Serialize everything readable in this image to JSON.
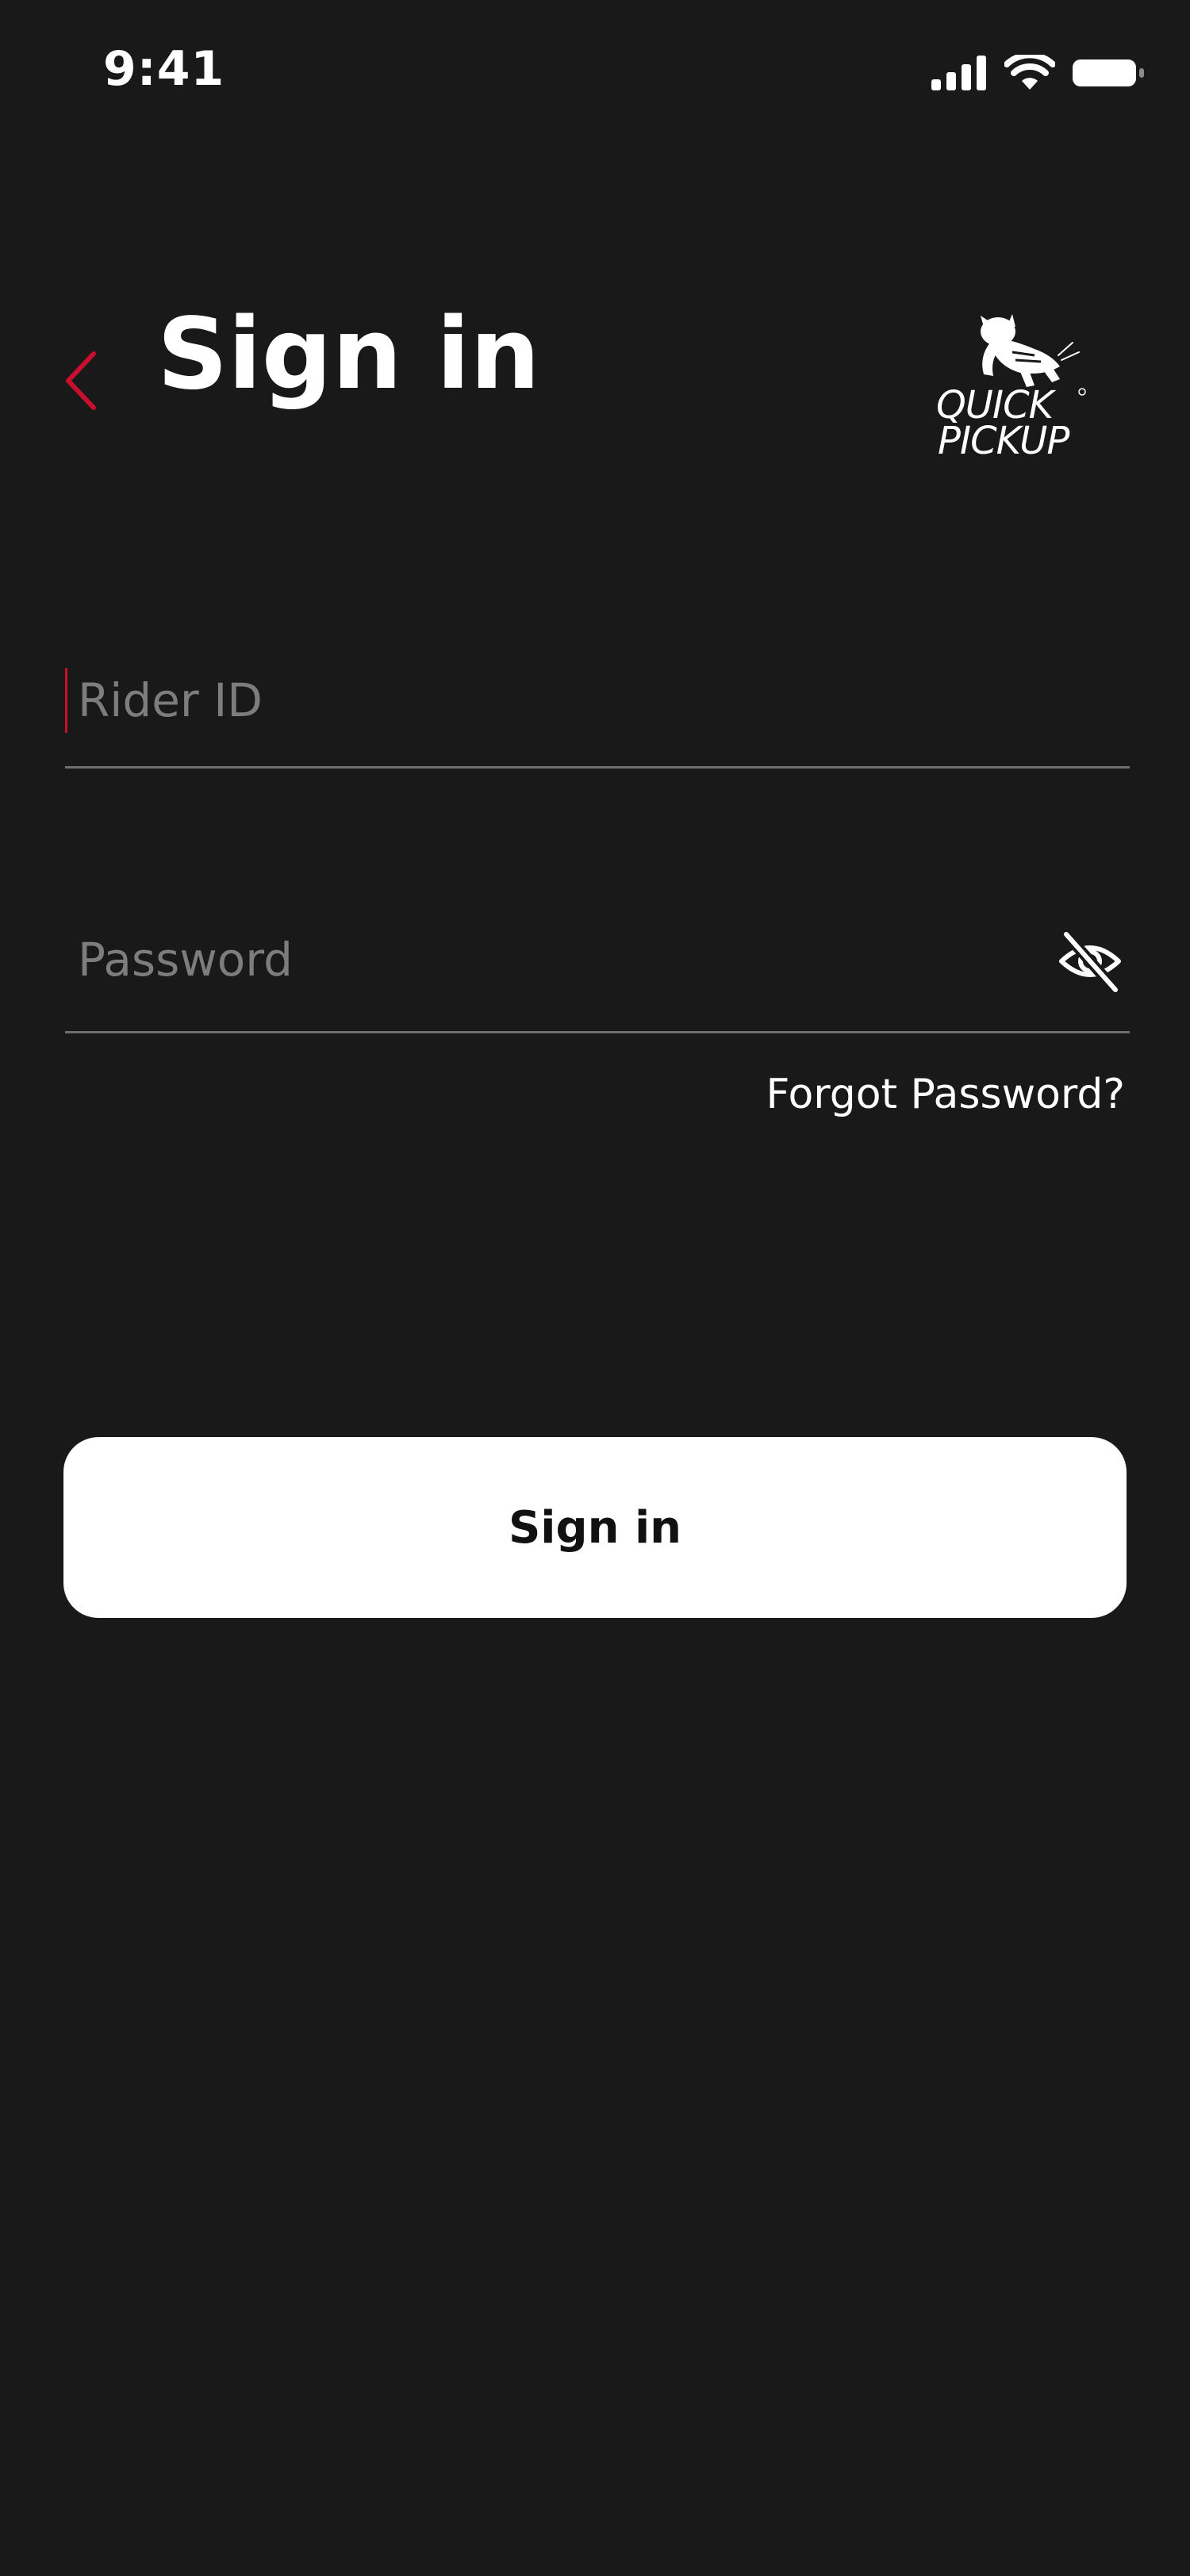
{
  "status_bar": {
    "time": "9:41",
    "icons": [
      "cellular-signal-icon",
      "wifi-icon",
      "battery-icon"
    ]
  },
  "header": {
    "back_icon": "chevron-left-icon",
    "title": "Sign in",
    "logo": {
      "line1": "QUICK",
      "line2": "PICKUP"
    }
  },
  "form": {
    "rider_id": {
      "value": "",
      "placeholder": "Rider ID"
    },
    "password": {
      "value": "",
      "placeholder": "Password",
      "toggle_icon": "eye-off-icon"
    },
    "forgot_password": "Forgot Password?",
    "submit_label": "Sign in"
  },
  "colors": {
    "background": "#191919",
    "accent": "#c8102e",
    "text": "#ffffff",
    "placeholder": "#7d7d7d",
    "divider": "#6e6e6e",
    "button_bg": "#ffffff",
    "button_text": "#111111"
  }
}
